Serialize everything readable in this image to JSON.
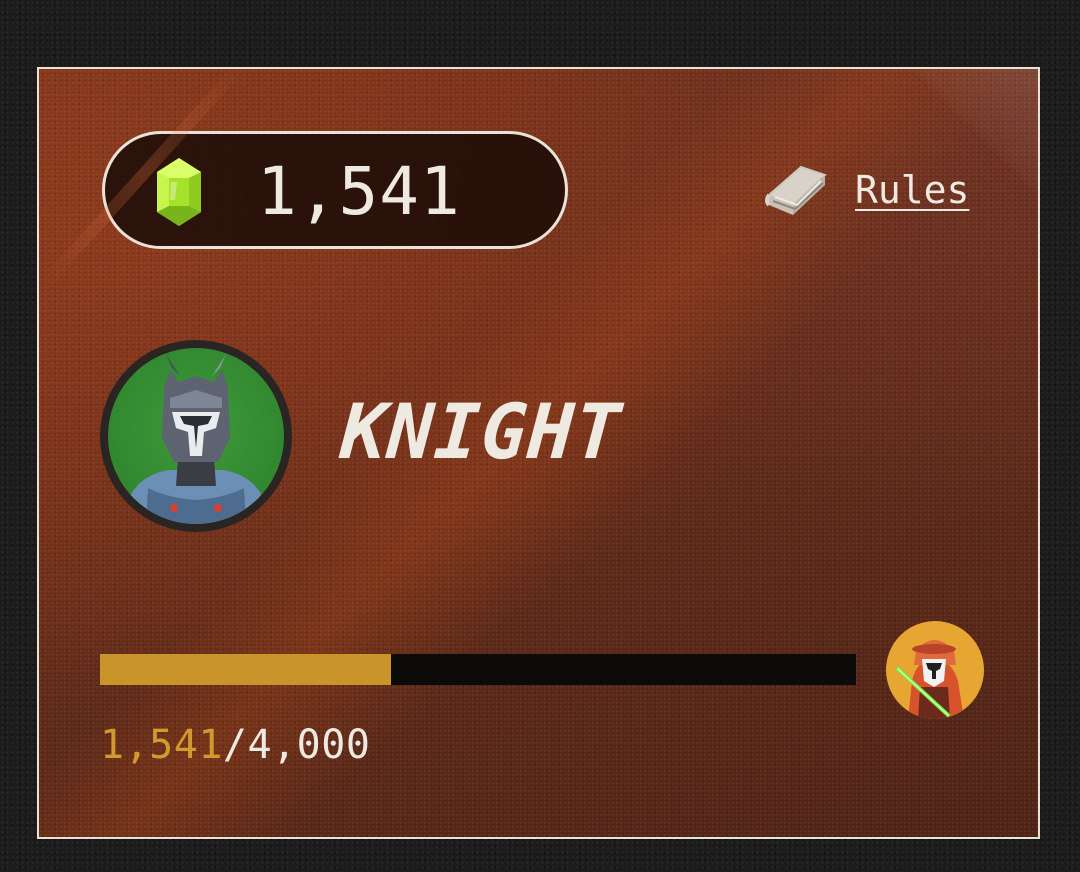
{
  "balance": {
    "icon": "green-gem-icon",
    "value": "1,541",
    "gem_color": "#9be22c"
  },
  "rules": {
    "icon": "book-icon",
    "label": "Rules"
  },
  "rank": {
    "avatar_icon": "armored-knight-avatar",
    "title": "KNIGHT"
  },
  "progress": {
    "current": "1,541",
    "separator": "/",
    "target": "4,000",
    "fraction": 0.3853,
    "fill_color": "#c9942a",
    "next_rank_icon": "hooded-warrior-avatar"
  },
  "colors": {
    "card_border": "#e9e2d7",
    "text": "#eeeae2",
    "accent": "#d29a2e"
  }
}
